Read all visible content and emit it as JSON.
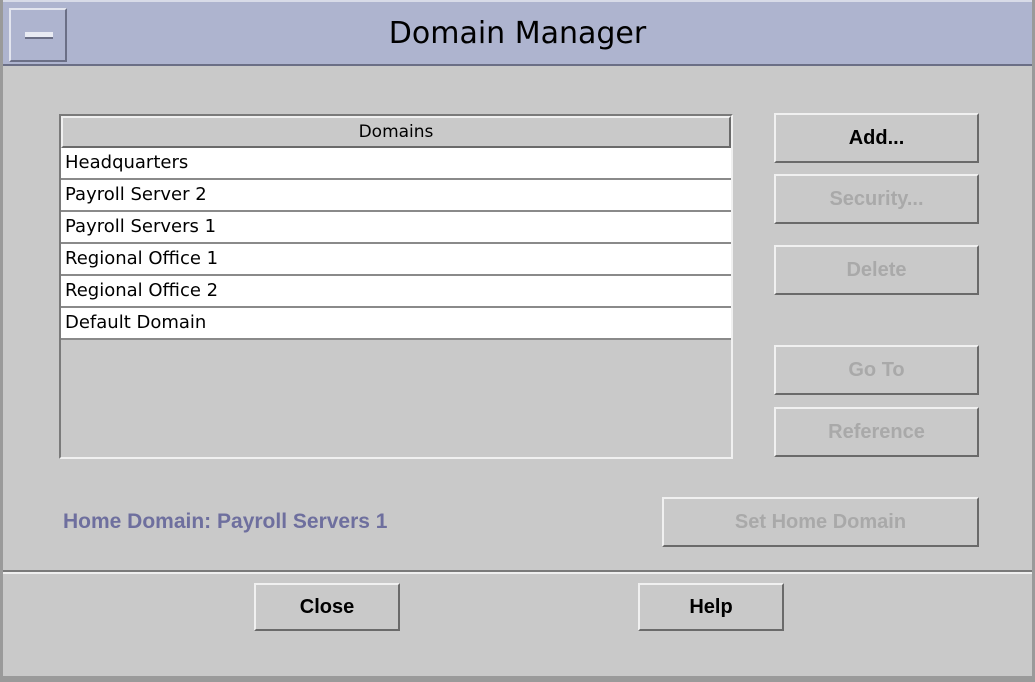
{
  "window": {
    "title": "Domain Manager"
  },
  "domains_list": {
    "header": "Domains",
    "items": [
      "Headquarters",
      "Payroll Server 2",
      "Payroll Servers 1",
      "Regional Office 1",
      "Regional Office 2",
      "Default Domain"
    ]
  },
  "buttons": {
    "add": "Add...",
    "security": "Security...",
    "delete": "Delete",
    "go_to": "Go To",
    "reference": "Reference",
    "set_home_domain": "Set Home Domain",
    "close": "Close",
    "help": "Help"
  },
  "home_domain": {
    "label": "Home Domain: Payroll Servers 1"
  },
  "colors": {
    "window_bg": "#c9c9c9",
    "titlebar_bg": "#aeb4cf",
    "home_domain_text": "#6e6f9e",
    "disabled_text": "#a9a9a9"
  }
}
